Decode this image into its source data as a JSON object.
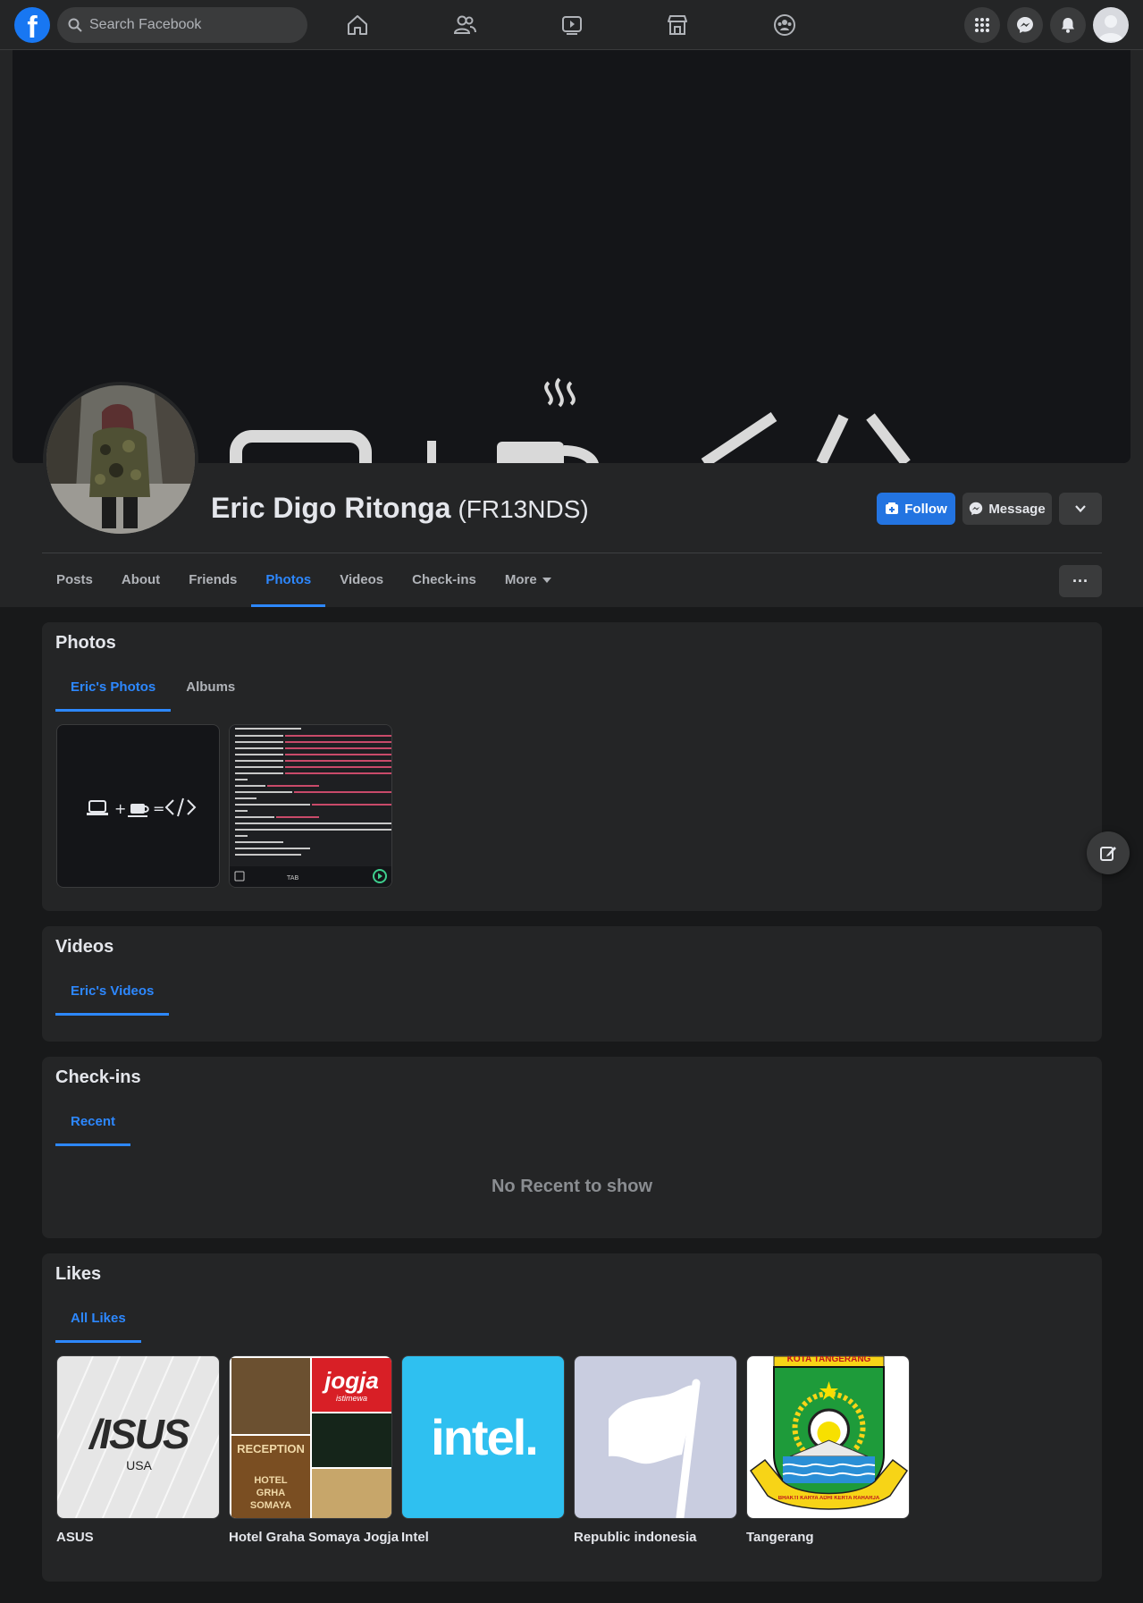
{
  "topbar": {
    "logo": "f",
    "search_placeholder": "Search Facebook",
    "nav_icons": [
      "home-icon",
      "friends-icon",
      "watch-icon",
      "marketplace-icon",
      "groups-icon"
    ],
    "right_icons": [
      "menu-grid-icon",
      "messenger-icon",
      "notifications-icon",
      "account-avatar"
    ]
  },
  "profile": {
    "name": "Eric Digo Ritonga",
    "alternate_name": "(FR13NDS)",
    "follow_label": "Follow",
    "message_label": "Message"
  },
  "tabs": [
    "Posts",
    "About",
    "Friends",
    "Photos",
    "Videos",
    "Check-ins",
    "More"
  ],
  "active_tab": "Photos",
  "more_button": "···",
  "photos": {
    "title": "Photos",
    "subtabs": [
      "Eric's Photos",
      "Albums"
    ],
    "items": [
      {
        "kind": "laptop-coffee-code",
        "text": "+ ="
      },
      {
        "kind": "code-screenshot",
        "toolbar_key": "TAB"
      }
    ]
  },
  "videos": {
    "title": "Videos",
    "subtabs": [
      "Eric's Videos"
    ]
  },
  "checkins": {
    "title": "Check-ins",
    "subtabs": [
      "Recent"
    ],
    "empty_text": "No Recent to show"
  },
  "likes": {
    "title": "Likes",
    "subtabs": [
      "All Likes"
    ],
    "items": [
      {
        "name": "ASUS",
        "logo_text": "/ISUS",
        "sub_text": "USA"
      },
      {
        "name": "Hotel Graha Somaya Jogja",
        "logo_text": "jogja",
        "sub_text": "istimewa",
        "extra": "RECEPTION",
        "extra2": "HOTEL GRHA SOMAYA"
      },
      {
        "name": "Intel",
        "logo_text": "intel."
      },
      {
        "name": "Republic indonesia"
      },
      {
        "name": "Tangerang",
        "logo_text": "KOTA TANGERANG",
        "sub_text": "BHAKTI KARYA ADHI KERTA RAHARJA"
      }
    ]
  },
  "colors": {
    "accent": "#2d88ff",
    "follow_button": "#2374e1",
    "background": "#18191a",
    "card": "#242526",
    "intel": "#2fc0f0"
  }
}
